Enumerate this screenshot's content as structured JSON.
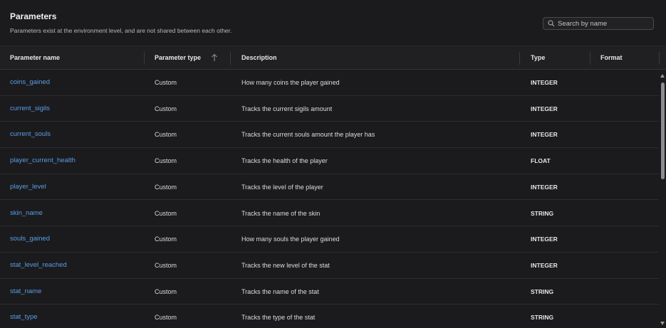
{
  "header": {
    "title": "Parameters",
    "subtitle": "Parameters exist at the environment level, and are not shared between each other."
  },
  "search": {
    "placeholder": "Search by name",
    "icon": "search-icon"
  },
  "table": {
    "columns": {
      "name": "Parameter name",
      "ptype": "Parameter type",
      "desc": "Description",
      "dtype": "Type",
      "format": "Format"
    },
    "sort": {
      "column": "Parameter type",
      "direction": "ascending",
      "icon": "arrow-up-icon"
    },
    "rows": [
      {
        "name": "coins_gained",
        "ptype": "Custom",
        "desc": "How many coins the player gained",
        "dtype": "INTEGER",
        "format": ""
      },
      {
        "name": "current_sigils",
        "ptype": "Custom",
        "desc": "Tracks the current sigils amount",
        "dtype": "INTEGER",
        "format": ""
      },
      {
        "name": "current_souls",
        "ptype": "Custom",
        "desc": "Tracks the current souls amount the player has",
        "dtype": "INTEGER",
        "format": ""
      },
      {
        "name": "player_current_health",
        "ptype": "Custom",
        "desc": "Tracks the health of the player",
        "dtype": "FLOAT",
        "format": ""
      },
      {
        "name": "player_level",
        "ptype": "Custom",
        "desc": "Tracks the level of the player",
        "dtype": "INTEGER",
        "format": ""
      },
      {
        "name": "skin_name",
        "ptype": "Custom",
        "desc": "Tracks the name of the skin",
        "dtype": "STRING",
        "format": ""
      },
      {
        "name": "souls_gained",
        "ptype": "Custom",
        "desc": "How many souls the player gained",
        "dtype": "INTEGER",
        "format": ""
      },
      {
        "name": "stat_level_reached",
        "ptype": "Custom",
        "desc": "Tracks the new level of the stat",
        "dtype": "INTEGER",
        "format": ""
      },
      {
        "name": "stat_name",
        "ptype": "Custom",
        "desc": "Tracks the name of the stat",
        "dtype": "STRING",
        "format": ""
      },
      {
        "name": "stat_type",
        "ptype": "Custom",
        "desc": "Tracks the type of the stat",
        "dtype": "STRING",
        "format": ""
      }
    ]
  },
  "colors": {
    "background": "#1b1b1d",
    "header_row": "#202022",
    "link": "#5b9de6",
    "text": "#dcdcde"
  }
}
